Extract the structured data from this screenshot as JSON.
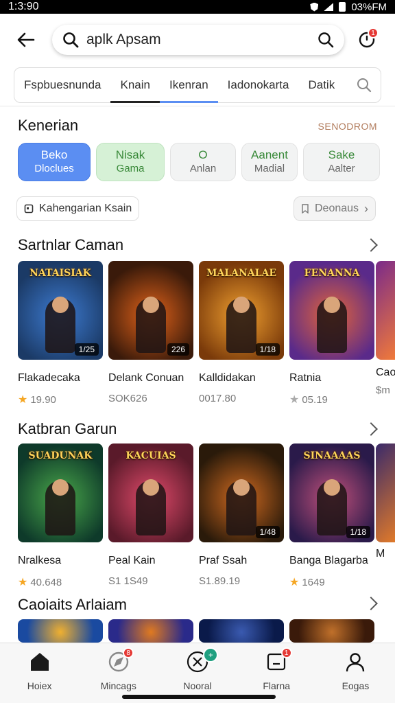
{
  "status": {
    "time": "1:3:90",
    "right_text": "03%FM"
  },
  "search": {
    "query": "aplk Apsam",
    "notif_badge": "1"
  },
  "tabs": [
    {
      "label": "Fspbuesnunda",
      "style": ""
    },
    {
      "label": "Knain",
      "style": "a1"
    },
    {
      "label": "Ikenran",
      "style": "a2"
    },
    {
      "label": "Iadonokarta",
      "style": ""
    },
    {
      "label": "Datik",
      "style": ""
    }
  ],
  "categories": {
    "title": "Kenerian",
    "see_all": "SENODROM",
    "chips": [
      {
        "line1": "Beko",
        "line2": "Dloclues",
        "style": "blue"
      },
      {
        "line1": "Nisak",
        "line2": "Gama",
        "style": "green"
      },
      {
        "line1": "O",
        "line2": "Anlan",
        "style": "g w100"
      },
      {
        "line1": "Aanent",
        "line2": "Madial",
        "style": "g w80"
      },
      {
        "line1": "Sake",
        "line2": "Aalter",
        "style": "g w112"
      }
    ],
    "left_pill": "Kahengarian Ksain",
    "right_pill": "Deonaus"
  },
  "sections": [
    {
      "title": "Sartnlar Caman",
      "games": [
        {
          "title_art": "NATAISIAK",
          "name": "Flakadecaka",
          "price": "19.90",
          "star": "gold",
          "tag": "1/25",
          "c1": "#1b3a66",
          "c2": "#3d7bd1"
        },
        {
          "title_art": "",
          "name": "Delank Conuan",
          "price": "SOK626",
          "star": "",
          "tag": "226",
          "c1": "#3a1a0a",
          "c2": "#e0621a"
        },
        {
          "title_art": "MALANALAE",
          "name": "Kalldidakan",
          "price": "0017.80",
          "star": "",
          "tag": "1/18",
          "c1": "#7a3a0a",
          "c2": "#f0a030"
        },
        {
          "title_art": "FENANNA",
          "name": "Ratnia",
          "price": "05.19",
          "star": "grey",
          "tag": "",
          "c1": "#5a2a8a",
          "c2": "#e2643a"
        }
      ],
      "partial": {
        "name": "Cao",
        "price": "$m"
      }
    },
    {
      "title": "Katbran Garun",
      "games": [
        {
          "title_art": "SUADUNAK",
          "name": "Nralkesa",
          "price": "40.648",
          "star": "gold",
          "tag": "",
          "c1": "#0e3a2a",
          "c2": "#4aa84a"
        },
        {
          "title_art": "KACUIAS",
          "name": "Peal Kain",
          "price": "S1 1S49",
          "star": "",
          "tag": "",
          "c1": "#5a1a2a",
          "c2": "#e04a6a"
        },
        {
          "title_art": "",
          "name": "Praf Ssah",
          "price": "S1.89.19",
          "star": "",
          "tag": "1/48",
          "c1": "#2a1a0a",
          "c2": "#d06a20"
        },
        {
          "title_art": "SINAAAAS",
          "name": "Banga Blagarba",
          "price": "1649",
          "star": "gold",
          "tag": "1/18",
          "c1": "#2a1a4a",
          "c2": "#c0507a"
        }
      ],
      "partial": {
        "name": "M",
        "price": ""
      }
    },
    {
      "title": "Caoiaits Arlaiam",
      "games": [
        {
          "c1": "#1a4aa0",
          "c2": "#f0b030"
        },
        {
          "c1": "#2a2a8a",
          "c2": "#e07a20"
        },
        {
          "c1": "#0a1a4a",
          "c2": "#3a5ab0"
        },
        {
          "c1": "#3a1a0a",
          "c2": "#c0702a"
        }
      ]
    }
  ],
  "bottom_nav": [
    {
      "label": "Hoiex",
      "icon": "home-icon",
      "badge": ""
    },
    {
      "label": "Mincags",
      "icon": "compass-icon",
      "badge": "8"
    },
    {
      "label": "Nooral",
      "icon": "x-circle-icon",
      "badge": "+"
    },
    {
      "label": "Flarna",
      "icon": "notification-icon",
      "badge": "1"
    },
    {
      "label": "Eogas",
      "icon": "profile-icon",
      "badge": ""
    }
  ]
}
